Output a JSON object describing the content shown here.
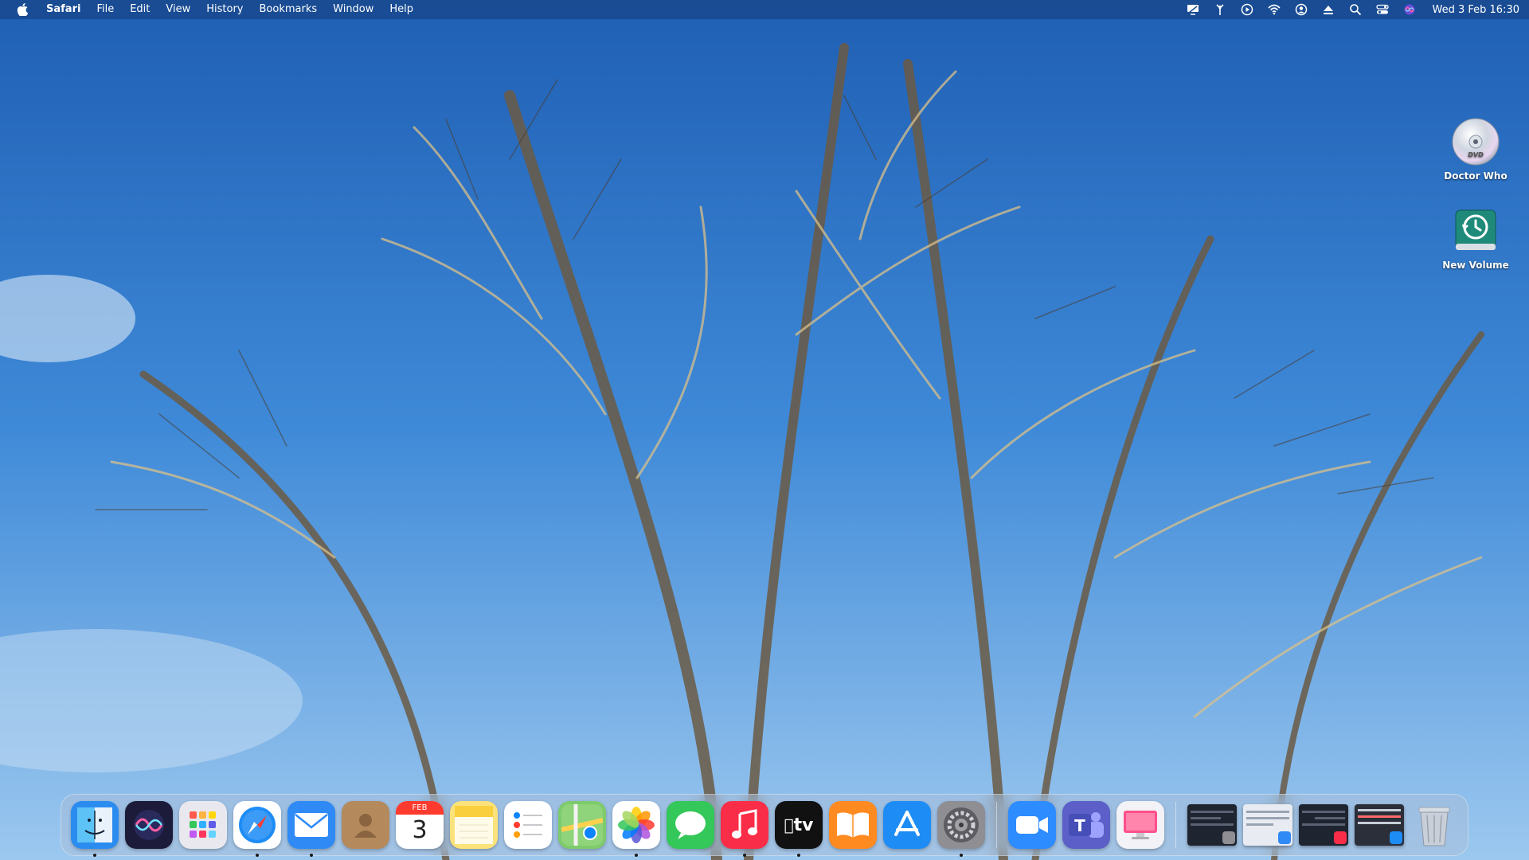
{
  "menubar": {
    "app_name": "Safari",
    "items": [
      "File",
      "Edit",
      "View",
      "History",
      "Bookmarks",
      "Window",
      "Help"
    ],
    "clock": "Wed 3 Feb  16:30",
    "status_icons": [
      "display-icon",
      "antenna-icon",
      "play-circle-icon",
      "wifi-icon",
      "user-circle-icon",
      "eject-icon",
      "search-icon",
      "control-center-icon",
      "siri-icon"
    ]
  },
  "desktop": {
    "icons": [
      {
        "label": "Doctor Who",
        "icon": "dvd-icon"
      },
      {
        "label": "New Volume",
        "icon": "time-machine-drive-icon"
      }
    ]
  },
  "dock": {
    "apps": [
      {
        "name": "Finder",
        "icon": "finder-icon",
        "color": "#2b8cf0",
        "running": true
      },
      {
        "name": "Siri",
        "icon": "siri-icon",
        "color": "#2a2a5c",
        "running": false
      },
      {
        "name": "Launchpad",
        "icon": "launchpad-icon",
        "color": "#e8e8ee",
        "running": false
      },
      {
        "name": "Safari",
        "icon": "safari-icon",
        "color": "#ffffff",
        "running": true
      },
      {
        "name": "Mail",
        "icon": "mail-icon",
        "color": "#2f8af5",
        "running": true
      },
      {
        "name": "Contacts",
        "icon": "contacts-icon",
        "color": "#b48a5c",
        "running": false
      },
      {
        "name": "Calendar",
        "icon": "calendar-icon",
        "month": "FEB",
        "day": "3",
        "running": false
      },
      {
        "name": "Notes",
        "icon": "notes-icon",
        "color": "#fbe27a",
        "running": false
      },
      {
        "name": "Reminders",
        "icon": "reminders-icon",
        "color": "#ffffff",
        "running": false
      },
      {
        "name": "Maps",
        "icon": "maps-icon",
        "color": "#7ecb6c",
        "running": false
      },
      {
        "name": "Photos",
        "icon": "photos-icon",
        "color": "#ffffff",
        "running": true
      },
      {
        "name": "Messages",
        "icon": "messages-icon",
        "color": "#34c759",
        "running": false
      },
      {
        "name": "Music",
        "icon": "music-icon",
        "color": "#fa2d48",
        "running": true
      },
      {
        "name": "TV",
        "icon": "tv-icon",
        "color": "#111111",
        "label": "tv",
        "running": true
      },
      {
        "name": "Books",
        "icon": "books-icon",
        "color": "#ff8a1f",
        "running": false
      },
      {
        "name": "App Store",
        "icon": "app-store-icon",
        "color": "#1e8cf5",
        "running": false
      },
      {
        "name": "System Preferences",
        "icon": "system-preferences-icon",
        "color": "#8e8e93",
        "running": true
      }
    ],
    "apps2": [
      {
        "name": "Zoom",
        "icon": "zoom-icon",
        "color": "#2d8cff",
        "running": false
      },
      {
        "name": "Teams",
        "icon": "teams-icon",
        "color": "#5b5fc7",
        "running": false
      },
      {
        "name": "Screen Sharing",
        "icon": "screen-sharing-icon",
        "color": "#f2f2f7",
        "running": false
      }
    ],
    "minimized": [
      {
        "name": "minimized-system-preferences",
        "badge_icon": "gear-icon",
        "badge_color": "#8e8e93"
      },
      {
        "name": "minimized-mail",
        "badge_icon": "mail-icon",
        "badge_color": "#2f8af5"
      },
      {
        "name": "minimized-music",
        "badge_icon": "music-icon",
        "badge_color": "#fa2d48"
      },
      {
        "name": "minimized-safari",
        "badge_icon": "safari-icon",
        "badge_color": "#1e8cf5"
      }
    ],
    "trash": {
      "name": "Trash",
      "icon": "trash-icon"
    }
  }
}
